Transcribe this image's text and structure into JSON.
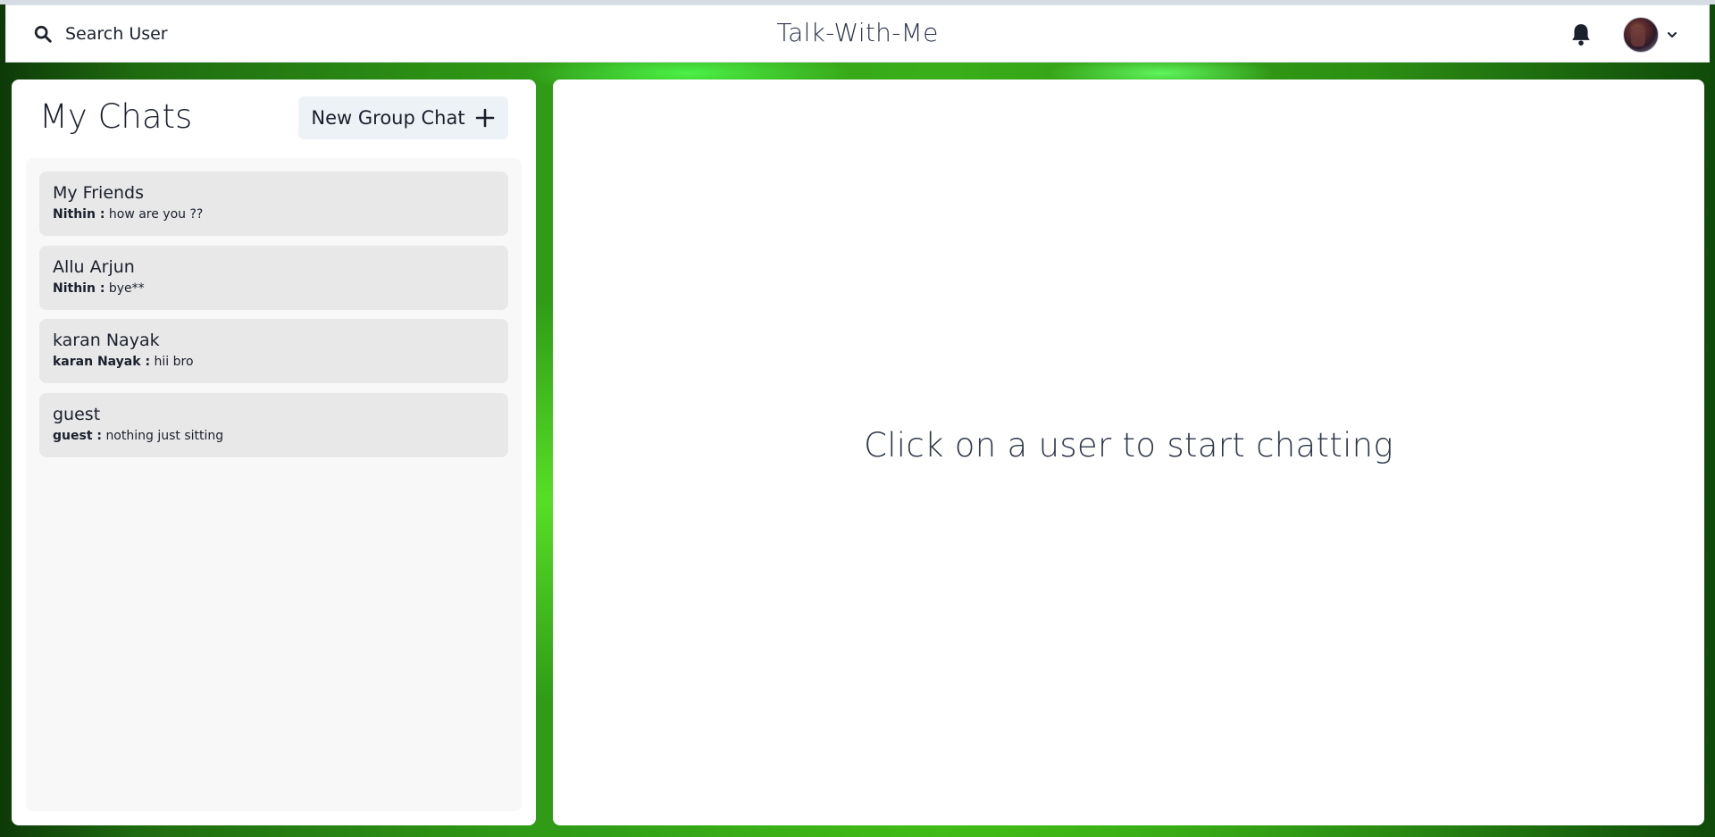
{
  "header": {
    "search_label": "Search User",
    "app_title": "Talk-With-Me",
    "icons": [
      "search-icon",
      "bell-icon",
      "chevron-down-icon"
    ]
  },
  "sidebar": {
    "title": "My Chats",
    "new_group_label": "New Group Chat",
    "chats": [
      {
        "name": "My Friends",
        "sender": "Nithin :",
        "message": "how are you ??"
      },
      {
        "name": "Allu Arjun",
        "sender": "Nithin :",
        "message": "bye**"
      },
      {
        "name": "karan Nayak",
        "sender": "karan Nayak :",
        "message": "hii bro"
      },
      {
        "name": "guest",
        "sender": "guest :",
        "message": "nothing just sitting"
      }
    ]
  },
  "main": {
    "placeholder": "Click on a user to start chatting"
  },
  "colors": {
    "panel_bg": "#ffffff",
    "chat_item_bg": "#e8e8e8",
    "button_bg": "#edf2f7",
    "background_accent": "#3aae1a"
  }
}
